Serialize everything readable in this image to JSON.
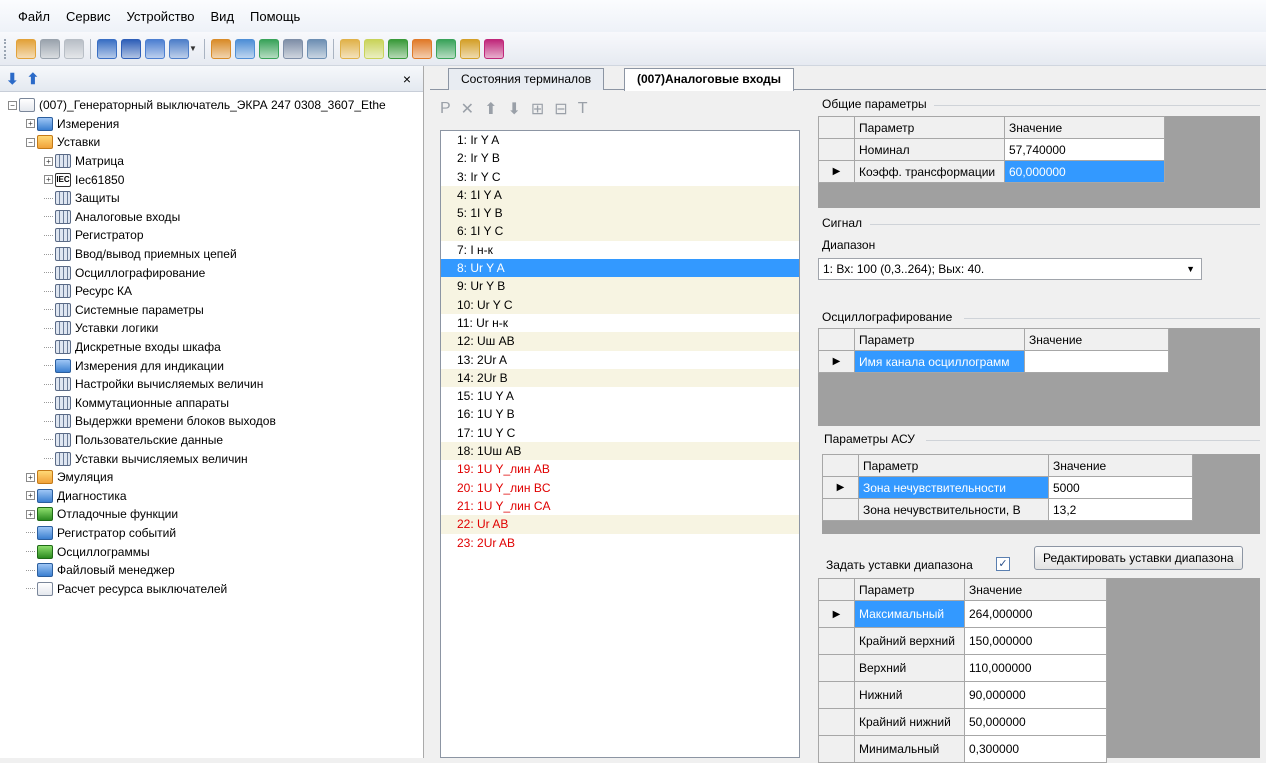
{
  "menu": [
    "Файл",
    "Сервис",
    "Устройство",
    "Вид",
    "Помощь"
  ],
  "toolbar_icons": [
    "users-icon",
    "users-gray-icon",
    "panel-gray-icon",
    "list-icon",
    "grid-blue-icon",
    "layout-icon",
    "table-dropdown-icon",
    "hierarchy-icon",
    "report-icon",
    "tree-icon",
    "filter-icon",
    "dial-icon",
    "folder-open-icon",
    "edit-icon",
    "export-icon",
    "chart-icon",
    "refresh-icon",
    "settings-icon",
    "flag-icon"
  ],
  "tree": {
    "close_label": "×",
    "items": [
      {
        "label": "(007)_Генераторный выключатель_ЭКРА 247 0308_3607_Ethe",
        "depth": 0,
        "exp": "−",
        "icon": "ic-doc",
        "icon_name": "device-icon"
      },
      {
        "label": "Измерения",
        "depth": 1,
        "exp": "+",
        "icon": "ic-blue",
        "icon_name": "measure-icon"
      },
      {
        "label": "Уставки",
        "depth": 1,
        "exp": "−",
        "icon": "ic-folder",
        "icon_name": "folder-icon"
      },
      {
        "label": "Матрица",
        "depth": 2,
        "exp": "+",
        "icon": "ic-grid",
        "icon_name": "matrix-icon"
      },
      {
        "label": "Iec61850",
        "depth": 2,
        "exp": "+",
        "icon": "ic-iec",
        "icon_name": "iec-icon"
      },
      {
        "label": "Защиты",
        "depth": 2,
        "exp": "",
        "icon": "ic-grid",
        "icon_name": "table-icon"
      },
      {
        "label": "Аналоговые входы",
        "depth": 2,
        "exp": "",
        "icon": "ic-grid",
        "icon_name": "table-icon"
      },
      {
        "label": "Регистратор",
        "depth": 2,
        "exp": "",
        "icon": "ic-grid",
        "icon_name": "table-icon"
      },
      {
        "label": "Ввод/вывод приемных цепей",
        "depth": 2,
        "exp": "",
        "icon": "ic-grid",
        "icon_name": "table-icon"
      },
      {
        "label": "Осциллографирование",
        "depth": 2,
        "exp": "",
        "icon": "ic-grid",
        "icon_name": "table-icon"
      },
      {
        "label": "Ресурс КА",
        "depth": 2,
        "exp": "",
        "icon": "ic-grid",
        "icon_name": "table-icon"
      },
      {
        "label": "Системные параметры",
        "depth": 2,
        "exp": "",
        "icon": "ic-grid",
        "icon_name": "table-icon"
      },
      {
        "label": "Уставки логики",
        "depth": 2,
        "exp": "",
        "icon": "ic-grid",
        "icon_name": "table-icon"
      },
      {
        "label": "Дискретные входы шкафа",
        "depth": 2,
        "exp": "",
        "icon": "ic-grid",
        "icon_name": "table-icon"
      },
      {
        "label": "Измерения для индикации",
        "depth": 2,
        "exp": "",
        "icon": "ic-blue",
        "icon_name": "indicator-icon"
      },
      {
        "label": "Настройки вычисляемых величин",
        "depth": 2,
        "exp": "",
        "icon": "ic-grid",
        "icon_name": "table-icon"
      },
      {
        "label": "Коммутационные аппараты",
        "depth": 2,
        "exp": "",
        "icon": "ic-grid",
        "icon_name": "table-icon"
      },
      {
        "label": "Выдержки времени блоков выходов",
        "depth": 2,
        "exp": "",
        "icon": "ic-grid",
        "icon_name": "table-icon"
      },
      {
        "label": "Пользовательские данные",
        "depth": 2,
        "exp": "",
        "icon": "ic-grid",
        "icon_name": "table-icon"
      },
      {
        "label": "Уставки вычисляемых величин",
        "depth": 2,
        "exp": "",
        "icon": "ic-grid",
        "icon_name": "table-icon"
      },
      {
        "label": "Эмуляция",
        "depth": 1,
        "exp": "+",
        "icon": "ic-folder",
        "icon_name": "emulation-icon"
      },
      {
        "label": "Диагностика",
        "depth": 1,
        "exp": "+",
        "icon": "ic-blue",
        "icon_name": "diagnostics-icon"
      },
      {
        "label": "Отладочные функции",
        "depth": 1,
        "exp": "+",
        "icon": "ic-green",
        "icon_name": "debug-icon"
      },
      {
        "label": "Регистратор событий",
        "depth": 1,
        "exp": "",
        "icon": "ic-blue",
        "icon_name": "event-log-icon"
      },
      {
        "label": "Осциллограммы",
        "depth": 1,
        "exp": "",
        "icon": "ic-green",
        "icon_name": "oscillogram-icon"
      },
      {
        "label": "Файловый менеджер",
        "depth": 1,
        "exp": "",
        "icon": "ic-blue",
        "icon_name": "file-manager-icon"
      },
      {
        "label": "Расчет ресурса выключателей",
        "depth": 1,
        "exp": "",
        "icon": "ic-doc",
        "icon_name": "calculator-icon"
      }
    ]
  },
  "tabs": [
    {
      "label": "Состояния терминалов",
      "active": false
    },
    {
      "label": "(007)Аналоговые входы",
      "active": true
    }
  ],
  "list_toolbar": [
    "P",
    "✕",
    "⬆",
    "⬇",
    "⊞",
    "⊟",
    "T"
  ],
  "list_items": [
    {
      "label": "1:  Ir Y A",
      "style": ""
    },
    {
      "label": "2:  Ir Y B",
      "style": ""
    },
    {
      "label": "3:  Ir Y C",
      "style": ""
    },
    {
      "label": "4:  1I Y A",
      "style": "alt"
    },
    {
      "label": "5:  1I Y B",
      "style": "alt"
    },
    {
      "label": "6:  1I Y C",
      "style": "alt"
    },
    {
      "label": "7:  I н-к",
      "style": ""
    },
    {
      "label": "8:  Ur Y A",
      "style": "sel"
    },
    {
      "label": "9:  Ur Y B",
      "style": "alt"
    },
    {
      "label": "10:  Ur Y C",
      "style": "alt"
    },
    {
      "label": "11:  Ur н-к",
      "style": ""
    },
    {
      "label": "12:  Uш AB",
      "style": "alt"
    },
    {
      "label": "13:  2Ur A",
      "style": ""
    },
    {
      "label": "14:  2Ur B",
      "style": "alt"
    },
    {
      "label": "15:  1U Y A",
      "style": ""
    },
    {
      "label": "16:  1U Y B",
      "style": ""
    },
    {
      "label": "17:  1U Y C",
      "style": ""
    },
    {
      "label": "18:  1Uш AB",
      "style": "alt"
    },
    {
      "label": "19:  1U Y_лин AB",
      "style": "red"
    },
    {
      "label": "20:  1U Y_лин BC",
      "style": "red"
    },
    {
      "label": "21:  1U Y_лин CA",
      "style": "red"
    },
    {
      "label": "22:  Ur AB",
      "style": "alt red"
    },
    {
      "label": "23:  2Ur AB",
      "style": "red"
    }
  ],
  "general": {
    "title": "Общие параметры",
    "col_param": "Параметр",
    "col_value": "Значение",
    "rows": [
      {
        "name": "Номинал",
        "value": "57,740000"
      },
      {
        "name": "Коэфф. трансформации",
        "value": "60,000000"
      }
    ]
  },
  "signal": {
    "title": "Сигнал",
    "range_label": "Диапазон",
    "range_value": "1: Вх: 100 (0,3..264); Вых: 40."
  },
  "osc": {
    "title": "Осциллографирование",
    "col_param": "Параметр",
    "col_value": "Значение",
    "rows": [
      {
        "name": "Имя канала осциллограмм",
        "value": ""
      }
    ]
  },
  "asu": {
    "title": "Параметры АСУ",
    "col_param": "Параметр",
    "col_value": "Значение",
    "rows": [
      {
        "name": "Зона нечувствительности",
        "value": "5000"
      },
      {
        "name": "Зона нечувствительности, В",
        "value": "13,2"
      }
    ]
  },
  "range_settings": {
    "checkbox_label": "Задать уставки диапазона",
    "checked": true,
    "edit_button": "Редактировать уставки диапазона",
    "col_param": "Параметр",
    "col_value": "Значение",
    "rows": [
      {
        "name": "Максимальный",
        "value": "264,000000"
      },
      {
        "name": "Крайний верхний",
        "value": "150,000000"
      },
      {
        "name": "Верхний",
        "value": "110,000000"
      },
      {
        "name": "Нижний",
        "value": "90,000000"
      },
      {
        "name": "Крайний нижний",
        "value": "50,000000"
      },
      {
        "name": "Минимальный",
        "value": "0,300000"
      }
    ]
  },
  "selection_color": "#3399ff",
  "warning_color": "#e00000"
}
